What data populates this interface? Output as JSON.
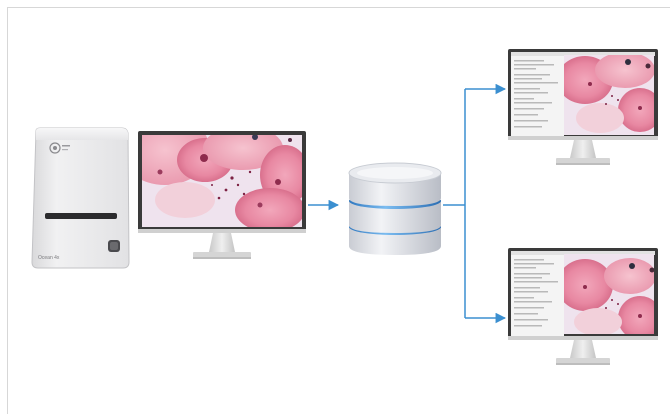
{
  "scanner": {
    "logo_text": "",
    "model_label": "Ocean 4x"
  },
  "colors": {
    "arrow": "#3b8fd0",
    "tissue_pink": "#e98fa8",
    "tissue_deep": "#c4506e",
    "tissue_light": "#f4cfd8",
    "background_lilac": "#efe3ee",
    "monitor_frame": "#3a3a3a",
    "stand": "#d9d9d9",
    "db_band": "#4f9bd9"
  },
  "icons": {
    "scanner": "slide-scanner-icon",
    "monitor": "monitor-icon",
    "database": "database-icon",
    "arrow": "arrow-right-icon"
  }
}
